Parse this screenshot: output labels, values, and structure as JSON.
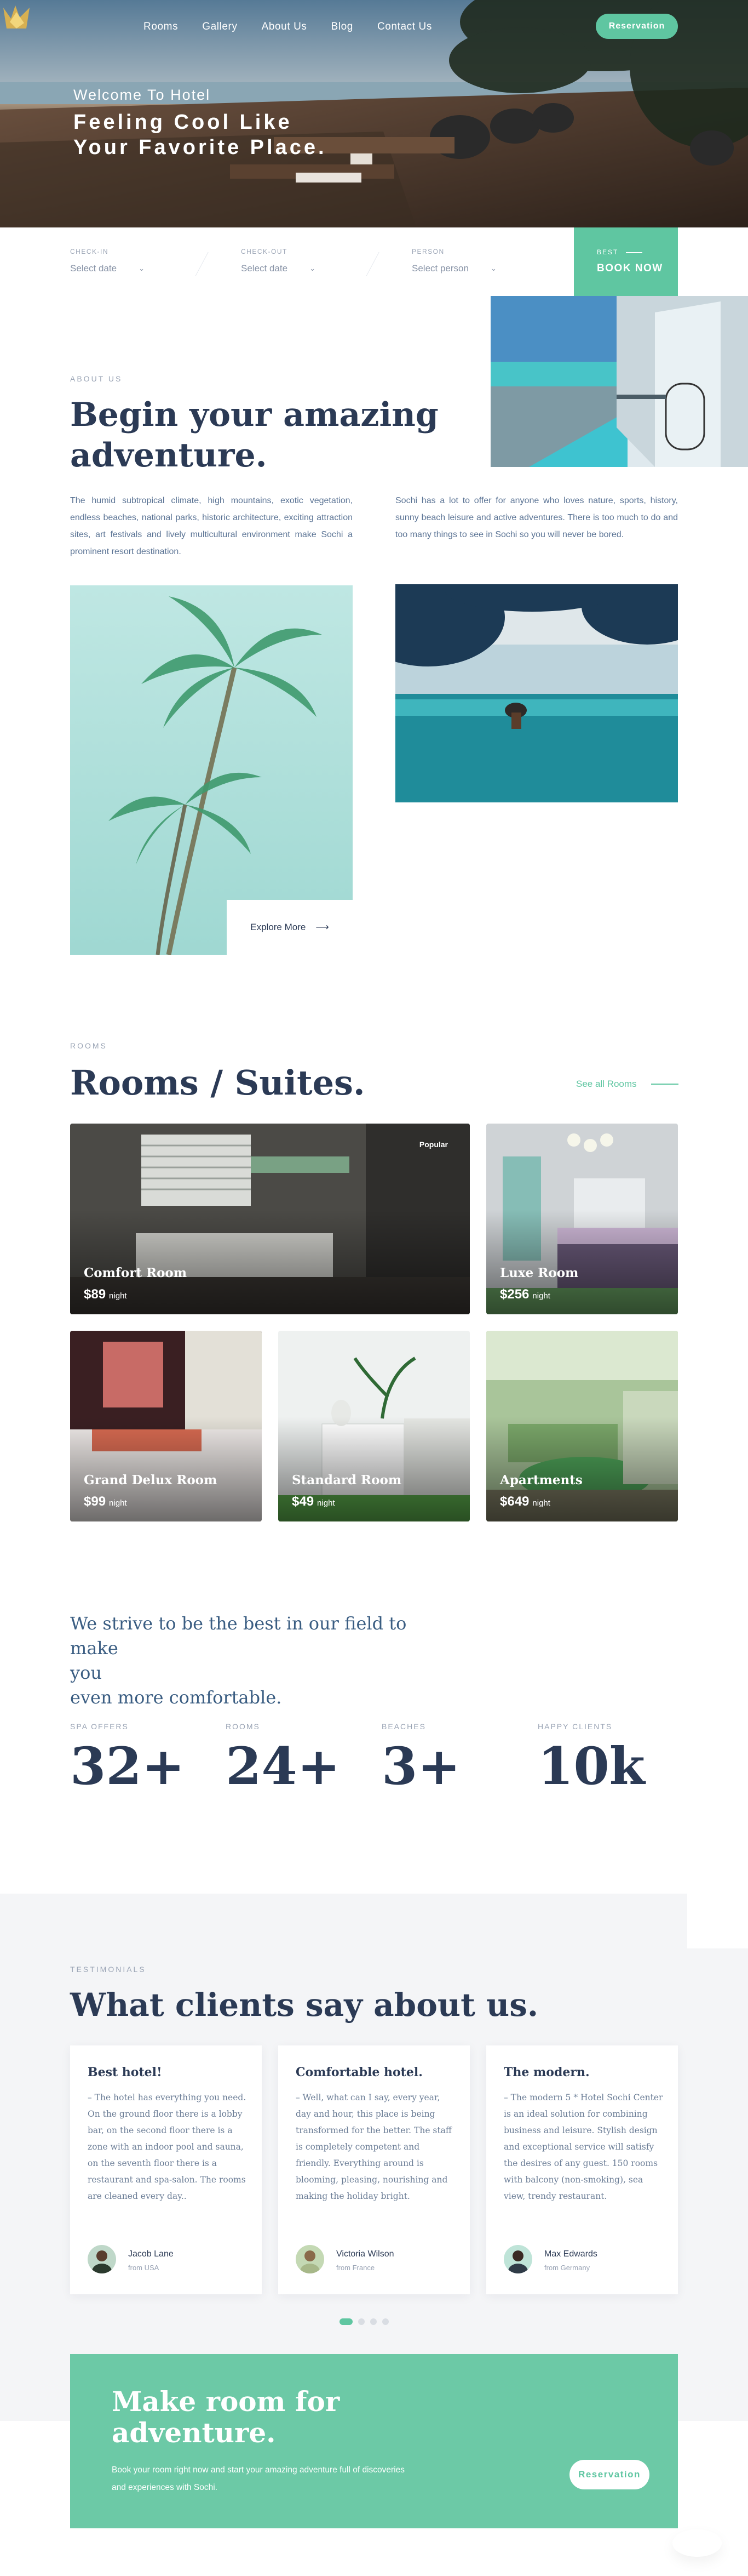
{
  "colors": {
    "accent": "#5fc6a1",
    "heading": "#2b3a55",
    "muted": "#9aa4b5",
    "testimonial_bg": "#f4f5f7"
  },
  "nav": {
    "logo_icon": "crown-leaf-logo",
    "links": [
      "Rooms",
      "Gallery",
      "About Us",
      "Blog",
      "Contact Us"
    ],
    "reservation": "Reservation"
  },
  "hero": {
    "welcome": "Welcome To Hotel",
    "title_line1": "Feeling Cool Like",
    "title_line2": "Your Favorite Place."
  },
  "booking": {
    "check_in": {
      "label": "CHECK-IN",
      "value": "Select date"
    },
    "check_out": {
      "label": "CHECK-OUT",
      "value": "Select date"
    },
    "person": {
      "label": "PERSON",
      "value": "Select person"
    },
    "book_small": "BEST",
    "book_now": "BOOK NOW"
  },
  "about": {
    "eyebrow": "ABOUT US",
    "title_line1": "Begin your amazing",
    "title_line2": "adventure.",
    "para_left": "The humid subtropical climate, high mountains, exotic vegetation, endless beaches, national parks, historic architecture, exciting attraction sites, art festivals and lively multicultural environment make Sochi a prominent resort destination.",
    "para_right": "Sochi has a lot to offer for anyone who loves nature, sports, history, sunny beach leisure and active adventures. There is too much to do and too many things to see in Sochi so you will never be bored.",
    "explore": "Explore More",
    "explore_arrow": "⟶"
  },
  "rooms": {
    "eyebrow": "ROOMS",
    "title": "Rooms / Suites.",
    "see_all": "See all Rooms",
    "items": [
      {
        "name": "Comfort Room",
        "price": "$89",
        "unit": "night",
        "badge": "Popular"
      },
      {
        "name": "Luxe Room",
        "price": "$256",
        "unit": "night"
      },
      {
        "name": "Grand Delux Room",
        "price": "$99",
        "unit": "night"
      },
      {
        "name": "Standard Room",
        "price": "$49",
        "unit": "night"
      },
      {
        "name": "Apartments",
        "price": "$649",
        "unit": "night"
      }
    ]
  },
  "stats": {
    "strive_line1": "We strive to be the best in our field to make",
    "strive_line2": "you",
    "strive_line3": "even more comfortable.",
    "items": [
      {
        "label": "SPA OFFERS",
        "value": "32+"
      },
      {
        "label": "ROOMS",
        "value": "24+"
      },
      {
        "label": "BEACHES",
        "value": "3+"
      },
      {
        "label": "HAPPY CLIENTS",
        "value": "10k"
      }
    ]
  },
  "testimonials": {
    "eyebrow": "TESTIMONIALS",
    "title": "What clients say about us.",
    "items": [
      {
        "title": "Best hotel!",
        "body": "– The hotel has everything you need. On the ground floor there is a lobby bar, on the second floor there is a zone with an indoor pool and sauna, on the seventh floor there is a restaurant and spa-salon. The rooms are cleaned every day..",
        "name": "Jacob Lane",
        "from": "from USA"
      },
      {
        "title": "Comfortable hotel.",
        "body": "– Well, what can I say, every year, day and hour, this place is being transformed for the better. The staff is completely competent and friendly. Everything around is blooming, pleasing, nourishing and making the holiday bright.",
        "name": "Victoria Wilson",
        "from": "from France"
      },
      {
        "title": "The modern.",
        "body": "– The modern 5 * Hotel Sochi Center is an ideal solution for combining business and leisure. Stylish design and exceptional service will satisfy the desires of any guest. 150 rooms with balcony (non-smoking), sea view, trendy restaurant.",
        "name": "Max Edwards",
        "from": "from Germany"
      }
    ],
    "active_slide": 1,
    "slide_count": 4
  },
  "cta": {
    "title_line1": "Make room for",
    "title_line2": "adventure.",
    "text": "Book your room right now and start your amazing adventure full of discoveries and experiences with Sochi.",
    "button": "Reservation"
  }
}
